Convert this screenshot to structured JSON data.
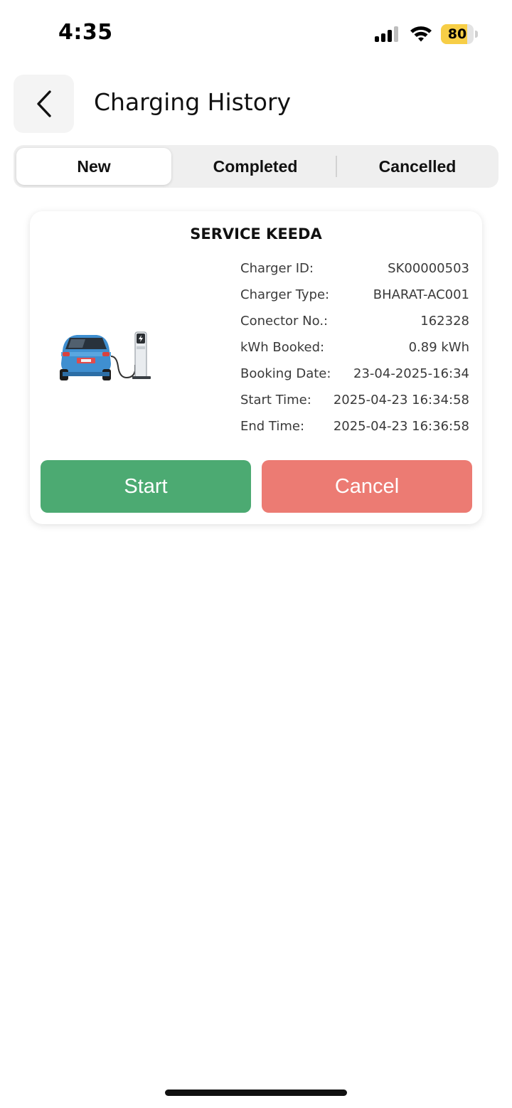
{
  "status_bar": {
    "time": "4:35",
    "battery": "80",
    "battery_level": 0.8
  },
  "header": {
    "title": "Charging History"
  },
  "tabs": [
    {
      "label": "New",
      "active": true
    },
    {
      "label": "Completed",
      "active": false
    },
    {
      "label": "Cancelled",
      "active": false
    }
  ],
  "card": {
    "title": "SERVICE KEEDA",
    "details": [
      {
        "label": "Charger ID:",
        "value": "SK00000503"
      },
      {
        "label": "Charger Type:",
        "value": "BHARAT-AC001"
      },
      {
        "label": "Conector No.:",
        "value": "162328"
      },
      {
        "label": "kWh Booked:",
        "value": "0.89 kWh"
      },
      {
        "label": "Booking Date:",
        "value": "23-04-2025-16:34"
      },
      {
        "label": "Start Time:",
        "value": "2025-04-23 16:34:58"
      },
      {
        "label": "End Time:",
        "value": "2025-04-23 16:36:58"
      }
    ],
    "start_label": "Start",
    "cancel_label": "Cancel"
  },
  "colors": {
    "start": "#4caa72",
    "cancel": "#ec7b73",
    "battery": "#f7ce46"
  },
  "icons": [
    "signal-icon",
    "wifi-icon",
    "battery-icon",
    "back-chevron-icon",
    "ev-charging-icon"
  ]
}
